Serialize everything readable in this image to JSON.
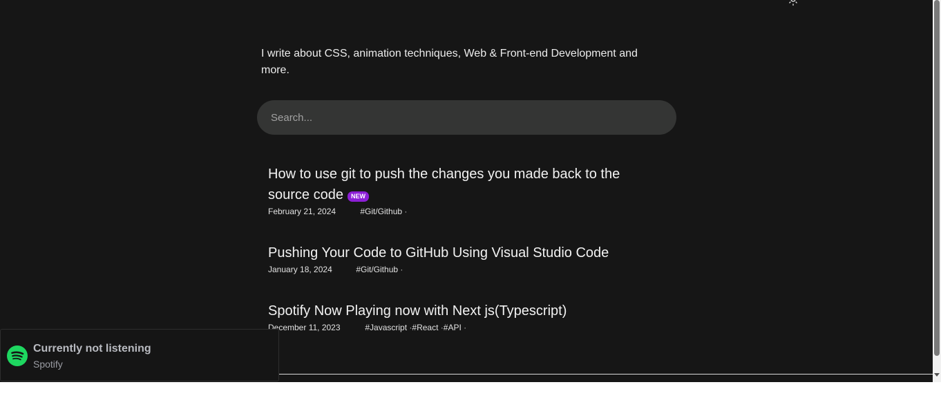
{
  "header": {
    "theme_toggle_icon": "sun-icon"
  },
  "intro": {
    "text": "I write about CSS, animation techniques, Web & Front-end Development and more."
  },
  "search": {
    "placeholder": "Search..."
  },
  "posts": [
    {
      "title": "How to use git to push the changes you made back to the source code",
      "badge": "NEW",
      "date": "February 21, 2024",
      "tags": [
        "#Git/Github"
      ]
    },
    {
      "title": "Pushing Your Code to GitHub Using Visual Studio Code",
      "date": "January 18, 2024",
      "tags": [
        "#Git/Github"
      ]
    },
    {
      "title": "Spotify Now Playing now with Next js(Typescript)",
      "date": "December 11, 2023",
      "tags": [
        "#Javascript",
        "#React",
        "#API"
      ]
    }
  ],
  "spotify": {
    "status": "Currently not listening",
    "label": "Spotify",
    "icon": "spotify-icon"
  },
  "colors": {
    "background": "#161616",
    "search_bg": "#343534",
    "badge_new": "#8c1fd6",
    "spotify_green": "#1ed760"
  }
}
